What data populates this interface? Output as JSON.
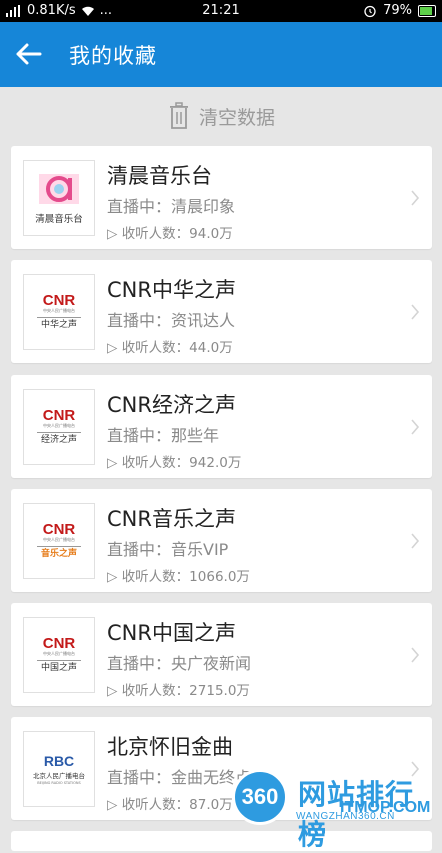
{
  "status_bar": {
    "speed": "0.81K/s",
    "dots": "...",
    "time": "21:21",
    "battery": "79%"
  },
  "app_bar": {
    "title": "我的收藏"
  },
  "clear": {
    "label": "清空数据"
  },
  "stations": [
    {
      "name": "清晨音乐台",
      "live": "直播中：清晨印象",
      "listeners": "收听人数：94.0万",
      "logo_text": "清晨音乐台",
      "logo_type": "music-a"
    },
    {
      "name": "CNR中华之声",
      "live": "直播中：资讯达人",
      "listeners": "收听人数：44.0万",
      "logo_text": "中华之声",
      "logo_type": "cnr"
    },
    {
      "name": "CNR经济之声",
      "live": "直播中：那些年",
      "listeners": "收听人数：942.0万",
      "logo_text": "经济之声",
      "logo_type": "cnr"
    },
    {
      "name": "CNR音乐之声",
      "live": "直播中：音乐VIP",
      "listeners": "收听人数：1066.0万",
      "logo_text": "音乐之声",
      "logo_type": "cnr-music"
    },
    {
      "name": "CNR中国之声",
      "live": "直播中：央广夜新闻",
      "listeners": "收听人数：2715.0万",
      "logo_text": "中国之声",
      "logo_type": "cnr"
    },
    {
      "name": "北京怀旧金曲",
      "live": "直播中：金曲无终点",
      "listeners": "收听人数：87.0万",
      "logo_text": "北京人民广播电台",
      "logo_sub": "BEIJING RADIO STATIONS",
      "logo_type": "rbc"
    }
  ],
  "cnr_logo": {
    "brand": "CNR",
    "sub": "中央人民广播电台"
  },
  "rbc_logo": {
    "brand": "RBC"
  },
  "watermark": {
    "badge": "360",
    "site_cn": "网站排行榜",
    "site_en": "WANGZHAN360.CN",
    "site_itm": "ITMOP.COM"
  },
  "colors": {
    "app_bar": "#1686d8",
    "background": "#e6e6e6",
    "cnr_red": "#c31a1a",
    "music_a": "#e44b8c",
    "music_orange": "#e67c1a"
  },
  "icons": {
    "back": "arrow-left-icon",
    "clear": "trash-icon",
    "listeners": "play-triangle-icon",
    "chevron": "chevron-right-icon"
  }
}
